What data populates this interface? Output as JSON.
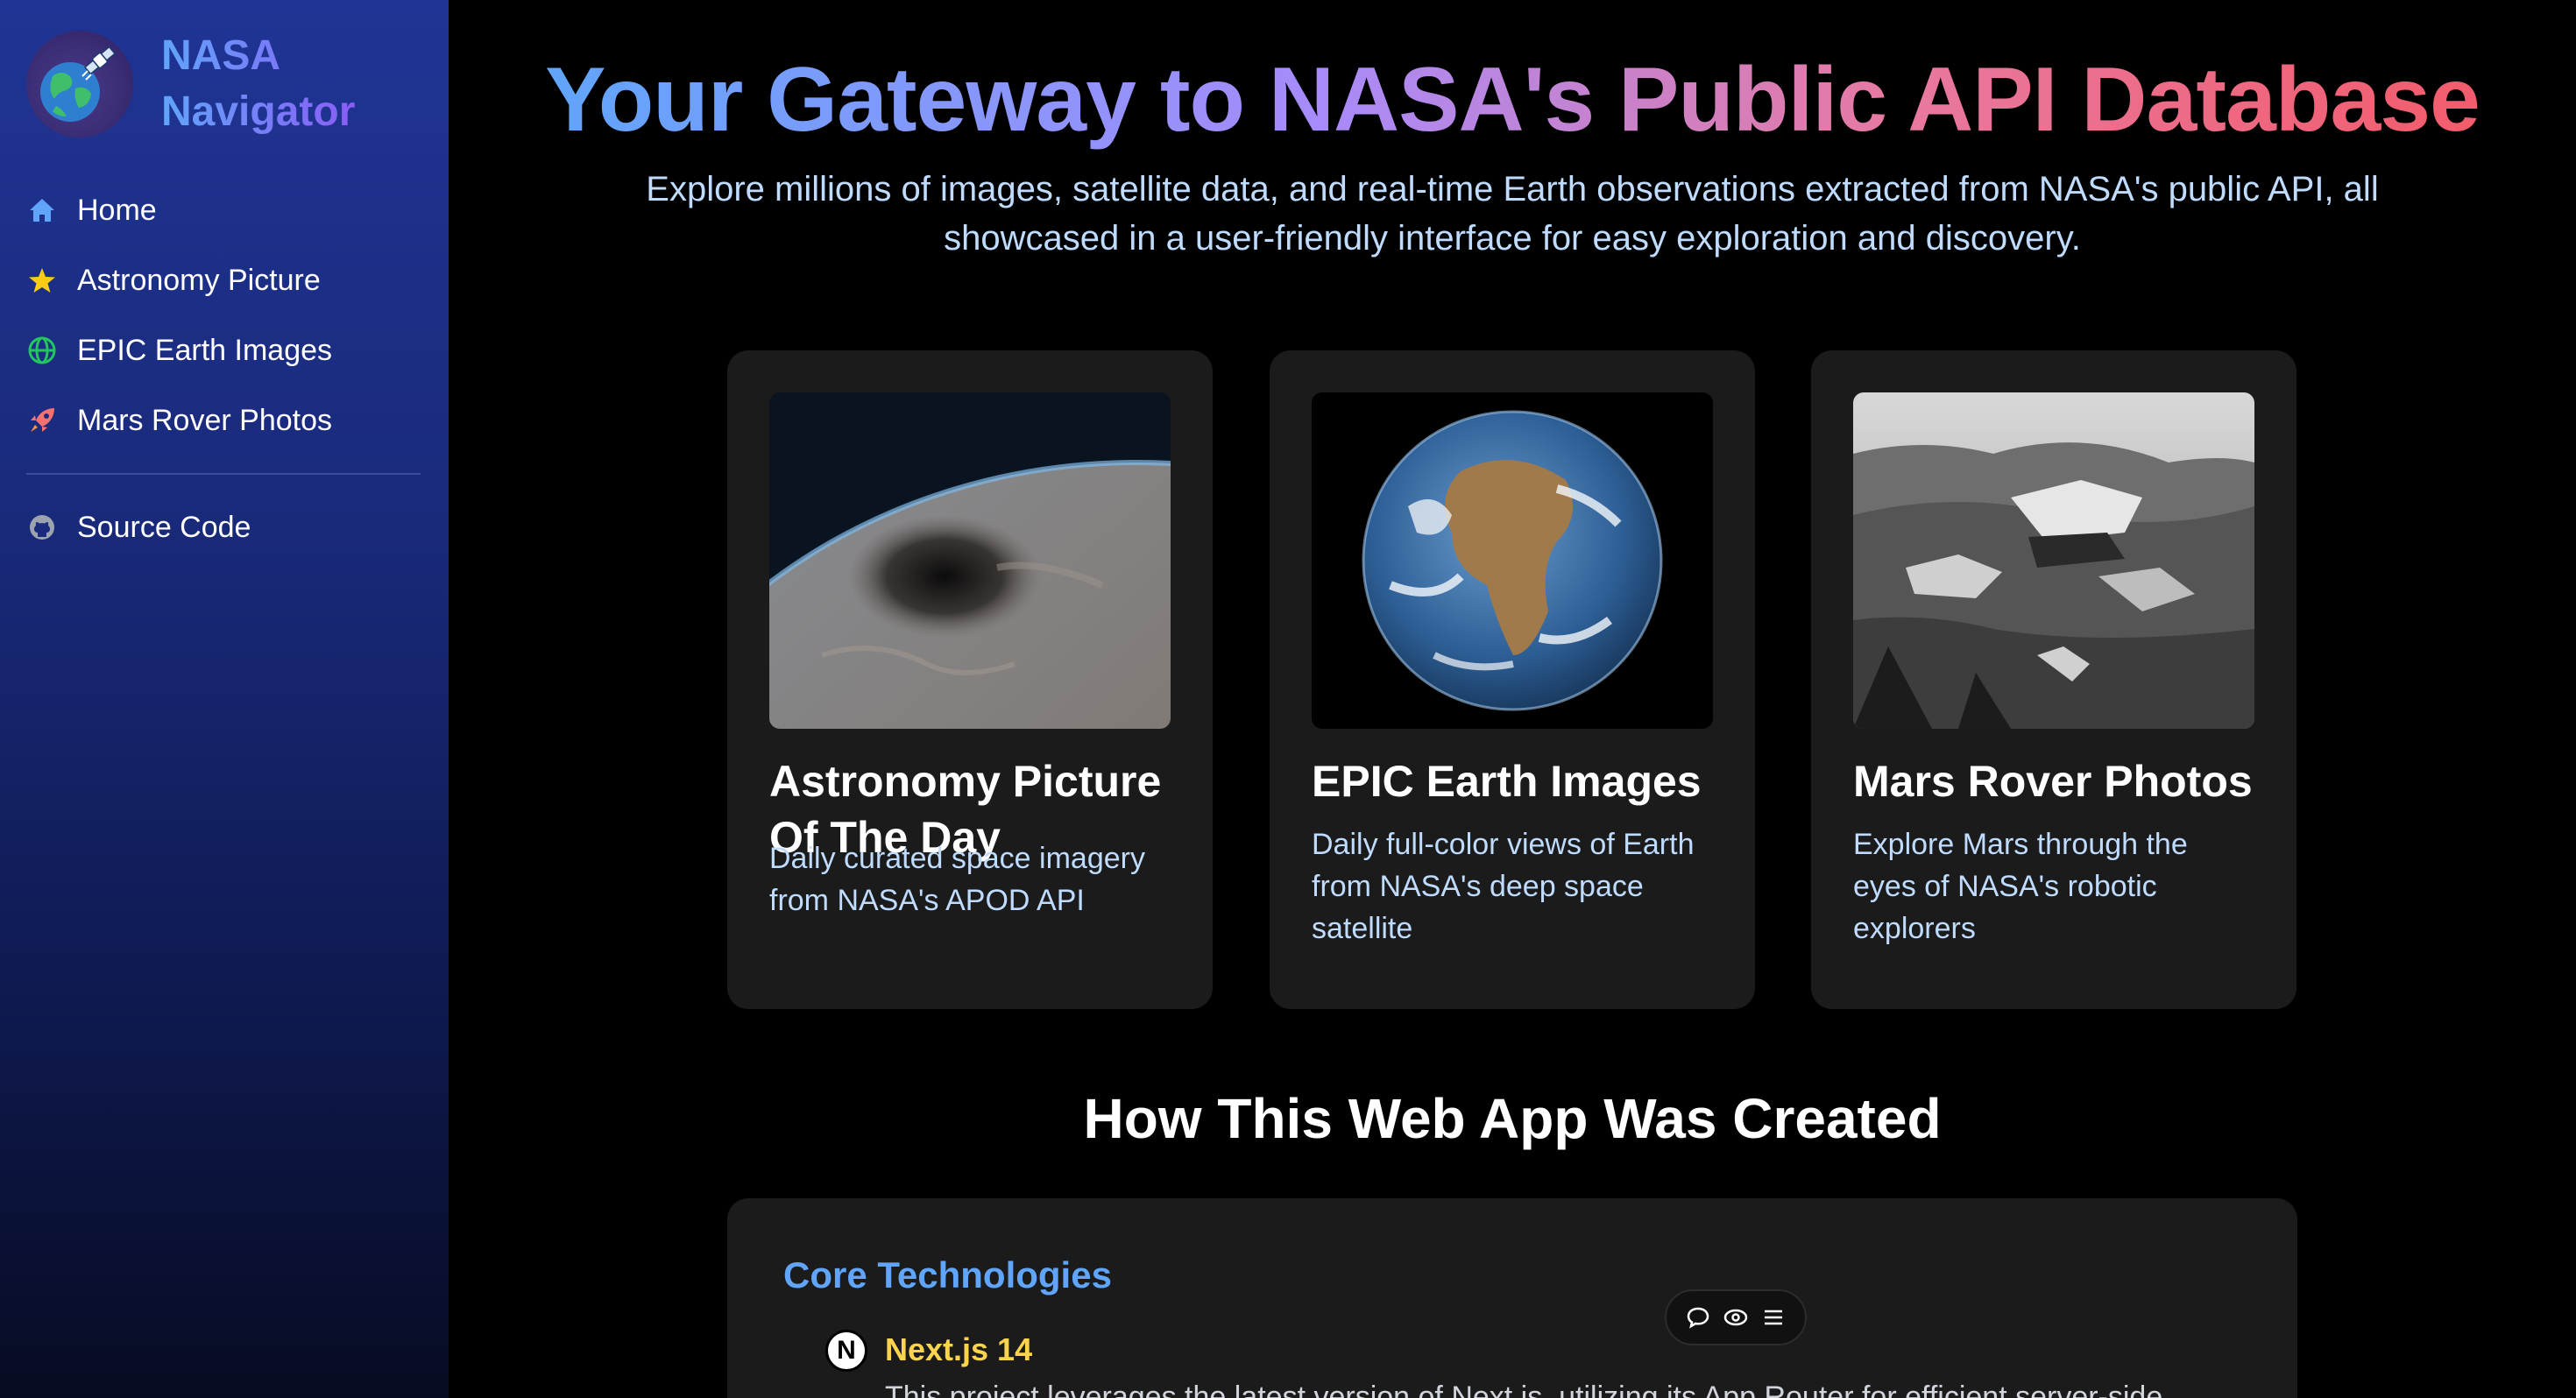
{
  "sidebar": {
    "brand": {
      "line1": "NASA",
      "line2": "Navigator"
    },
    "items": [
      {
        "label": "Home",
        "icon": "home-icon",
        "color": "#60a5fa"
      },
      {
        "label": "Astronomy Picture",
        "icon": "star-icon",
        "color": "#facc15"
      },
      {
        "label": "EPIC Earth Images",
        "icon": "globe-icon",
        "color": "#22c55e"
      },
      {
        "label": "Mars Rover Photos",
        "icon": "rocket-icon",
        "color": "#f87171"
      }
    ],
    "footer_items": [
      {
        "label": "Source Code",
        "icon": "github-icon",
        "color": "#9ca3af"
      }
    ]
  },
  "hero": {
    "title": "Your Gateway to NASA's Public API Database",
    "subtitle_line1": "Explore millions of images, satellite data, and real-time Earth observations extracted from NASA's public API, all",
    "subtitle_line2": "showcased in a user-friendly interface for easy exploration and discovery."
  },
  "cards": [
    {
      "title_line1": "Astronomy Picture",
      "title_line2": "Of The Day",
      "desc_line1": "Daily curated space imagery",
      "desc_line2": "from NASA's APOD API",
      "desc_line3": ""
    },
    {
      "title_line1": "EPIC Earth Images",
      "title_line2": "",
      "desc_line1": "Daily full-color views of Earth",
      "desc_line2": "from NASA's deep space",
      "desc_line3": "satellite"
    },
    {
      "title_line1": "Mars Rover Photos",
      "title_line2": "",
      "desc_line1": "Explore Mars through the",
      "desc_line2": "eyes of NASA's robotic",
      "desc_line3": "explorers"
    }
  ],
  "how_section": {
    "title": "How This Web App Was Created",
    "panel_heading": "Core Technologies",
    "item_icon_letter": "N",
    "item_name": "Next.js 14",
    "item_desc": "This project leverages the latest version of Next.js, utilizing its App Router for efficient server-side"
  },
  "toolbar": {
    "icons": [
      "comment-icon",
      "eye-icon",
      "menu-icon"
    ]
  }
}
